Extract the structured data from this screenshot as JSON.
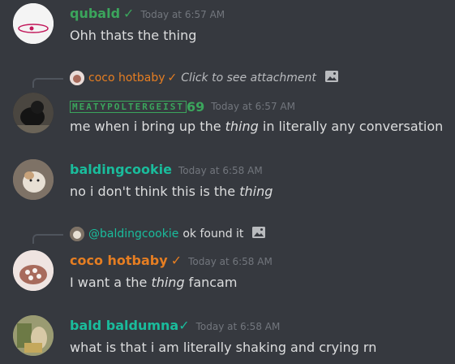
{
  "messages": [
    {
      "author": "qubald",
      "badge": "✓",
      "author_color": "#3ba55c",
      "timestamp": "Today at 6:57 AM",
      "text": "Ohh thats the thing"
    },
    {
      "reply": {
        "author": "coco hotbaby",
        "badge": "✓",
        "text": "Click to see attachment"
      },
      "author_boxed": "MEATYPOLTERGEIST",
      "author_suffix": "69",
      "author_color": "#3ba55c",
      "timestamp": "Today at 6:57 AM",
      "text_before": "me when i bring up the ",
      "text_italic": "thing",
      "text_after": " in literally any conversation"
    },
    {
      "author": "baldingcookie",
      "author_color": "#1abc9c",
      "timestamp": "Today at 6:58 AM",
      "text_before": "no i don't think this is the ",
      "text_italic": "thing",
      "text_after": ""
    },
    {
      "reply": {
        "mention": "@baldingcookie",
        "text": "ok found it"
      },
      "author": "coco hotbaby",
      "badge": "✓",
      "author_color": "#e67e22",
      "timestamp": "Today at 6:58 AM",
      "text_before": "I want a the ",
      "text_italic": "thing",
      "text_after": " fancam"
    },
    {
      "author": "bald baldumna",
      "badge": "✓",
      "author_color": "#1abc9c",
      "timestamp": "Today at 6:58 AM",
      "text": "what is that i am literally shaking and crying rn"
    }
  ],
  "colors": {
    "background": "#36393f",
    "text": "#dcddde",
    "timestamp": "#72767d",
    "reply_text": "#b9bbbe",
    "green": "#3ba55c",
    "orange": "#e67e22",
    "teal": "#1abc9c"
  },
  "icons": {
    "attachment": "image-icon",
    "check": "checkmark-icon"
  }
}
